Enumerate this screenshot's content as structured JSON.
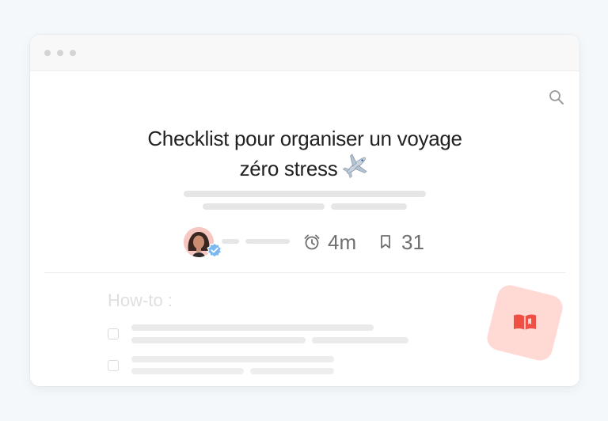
{
  "article": {
    "title_line1": "Checklist pour organiser un voyage",
    "title_line2": "zéro stress",
    "title_emoji": "✈️"
  },
  "meta": {
    "read_time": "4m",
    "bookmarks": "31"
  },
  "section": {
    "label": "How-to :"
  },
  "icons": {
    "search": "search-icon",
    "alarm": "alarm-clock-icon",
    "bookmark": "bookmark-icon",
    "verified": "verified-badge-icon",
    "book": "open-book-icon"
  },
  "colors": {
    "accent": "#ef4f45",
    "fab_background": "#ffd9d4",
    "verified": "#7bb8f0"
  }
}
